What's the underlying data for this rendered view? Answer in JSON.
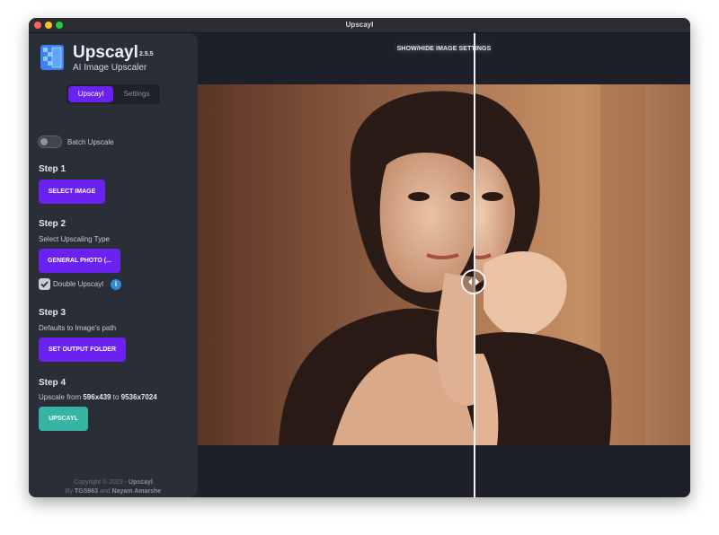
{
  "window": {
    "title": "Upscayl"
  },
  "app": {
    "name": "Upscayl",
    "version": "2.5.5",
    "subtitle": "AI Image Upscaler"
  },
  "tabs": [
    {
      "label": "Upscayl",
      "active": true
    },
    {
      "label": "Settings",
      "active": false
    }
  ],
  "batch": {
    "label": "Batch Upscale",
    "enabled": false
  },
  "step1": {
    "title": "Step 1",
    "button": "SELECT IMAGE"
  },
  "step2": {
    "title": "Step 2",
    "description": "Select Upscaling Type",
    "button": "GENERAL PHOTO (...",
    "double_upscayl": {
      "label": "Double Upscayl",
      "checked": true
    }
  },
  "step3": {
    "title": "Step 3",
    "description": "Defaults to Image's path",
    "button": "SET OUTPUT FOLDER"
  },
  "step4": {
    "title": "Step 4",
    "prefix": "Upscale from",
    "from": "596x439",
    "middle": "to",
    "to": "9536x7024",
    "button": "UPSCAYL"
  },
  "footer": {
    "copyright": "Copyright © 2023 -",
    "brand": "Upscayl",
    "by": "By",
    "author1": "TGS963",
    "and": "and",
    "author2": "Nayam Amarshe"
  },
  "main": {
    "toggle_settings_label": "SHOW/HIDE IMAGE SETTINGS"
  },
  "colors": {
    "accent": "#6b21f0",
    "upscayl_button": "#36b4a6",
    "sidebar": "#2a2e37",
    "background": "#1e2029"
  },
  "icons": {
    "logo": "upscayl-logo-icon",
    "info": "info-icon",
    "check": "check-icon",
    "compare": "compare-arrows-icon"
  }
}
